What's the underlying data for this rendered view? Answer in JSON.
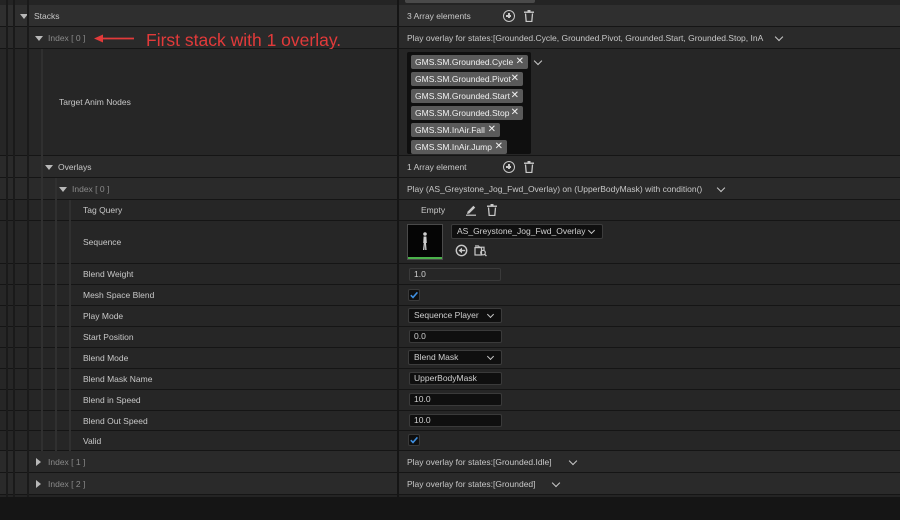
{
  "annotation": {
    "text": "First stack with 1 overlay.",
    "color": "#e23a3a"
  },
  "stacks": {
    "label": "Stacks",
    "value": "3 Array elements"
  },
  "index0": {
    "label": "Index [ 0 ]",
    "value": "Play overlay for states:[Grounded.Cycle, Grounded.Pivot, Grounded.Start, Grounded.Stop, InA"
  },
  "target_anim_nodes": {
    "label": "Target Anim Nodes",
    "tags": [
      "GMS.SM.Grounded.Cycle",
      "GMS.SM.Grounded.Pivot",
      "GMS.SM.Grounded.Start",
      "GMS.SM.Grounded.Stop",
      "GMS.SM.InAir.Fall",
      "GMS.SM.InAir.Jump"
    ]
  },
  "overlays": {
    "label": "Overlays",
    "value": "1 Array element"
  },
  "overlay_index0": {
    "label": "Index [ 0 ]",
    "value": "Play (AS_Greystone_Jog_Fwd_Overlay) on (UpperBodyMask) with condition()"
  },
  "tag_query": {
    "label": "Tag Query",
    "value": "Empty"
  },
  "sequence": {
    "label": "Sequence",
    "value": "AS_Greystone_Jog_Fwd_Overlay"
  },
  "blend_weight": {
    "label": "Blend Weight",
    "value": "1.0"
  },
  "mesh_space_blend": {
    "label": "Mesh Space Blend",
    "checked": true
  },
  "play_mode": {
    "label": "Play Mode",
    "value": "Sequence Player"
  },
  "start_position": {
    "label": "Start Position",
    "value": "0.0"
  },
  "blend_mode": {
    "label": "Blend Mode",
    "value": "Blend Mask"
  },
  "blend_mask_name": {
    "label": "Blend Mask Name",
    "value": "UpperBodyMask"
  },
  "blend_in_speed": {
    "label": "Blend in Speed",
    "value": "10.0"
  },
  "blend_out_speed": {
    "label": "Blend Out Speed",
    "value": "10.0"
  },
  "valid": {
    "label": "Valid",
    "checked": true
  },
  "index1": {
    "label": "Index [ 1 ]",
    "value": "Play overlay for states:[Grounded.Idle]"
  },
  "index2": {
    "label": "Index [ 2 ]",
    "value": "Play overlay for states:[Grounded]"
  },
  "colors": {
    "accent_check": "#3f8fe0",
    "thumb_bar": "#4bb24b",
    "annotation": "#e23a3a"
  }
}
